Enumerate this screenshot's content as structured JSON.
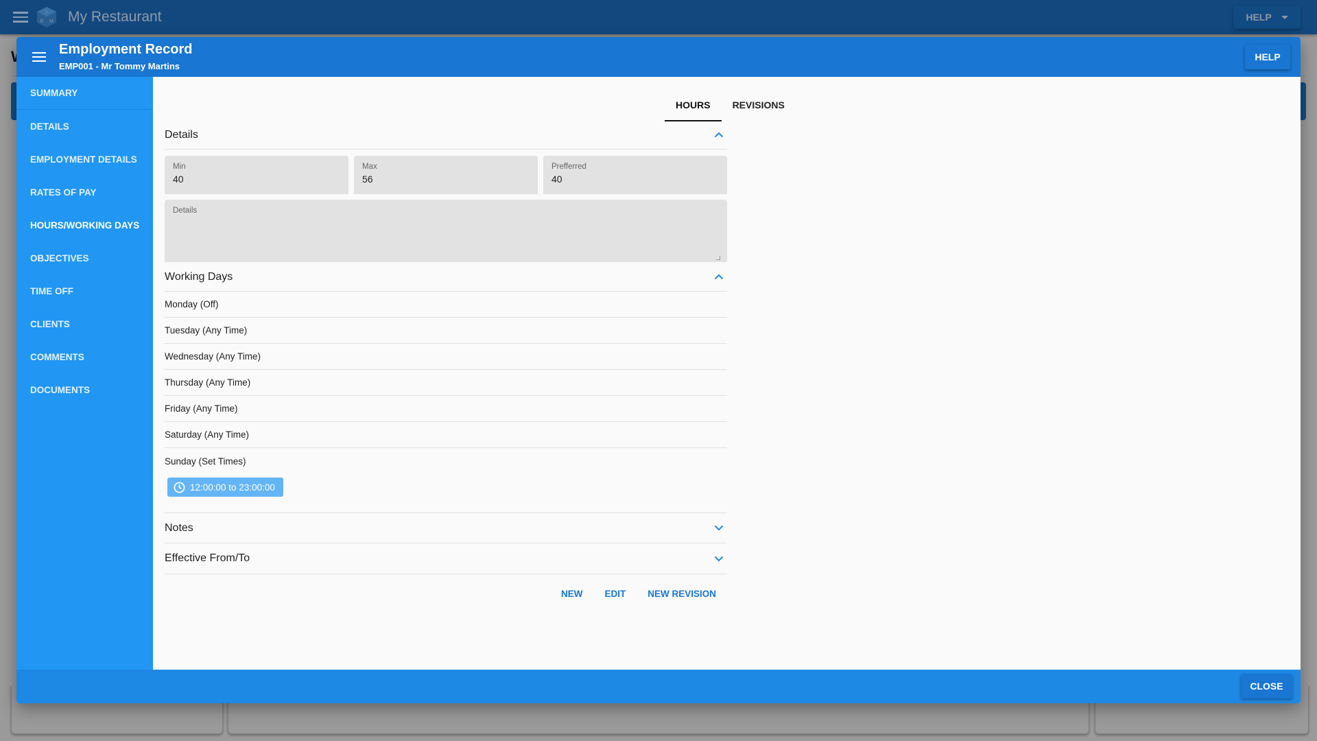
{
  "app": {
    "title": "My Restaurant",
    "help_menu_label": "HELP",
    "background_heading_initial": "W"
  },
  "modal": {
    "title": "Employment Record",
    "subtitle": "EMP001 - Mr Tommy Martins",
    "help_label": "HELP",
    "close_label": "CLOSE"
  },
  "sidebar": {
    "active": "HOURS/WORKING DAYS",
    "items": [
      {
        "label": "SUMMARY"
      },
      {
        "label": "DETAILS"
      },
      {
        "label": "EMPLOYMENT DETAILS"
      },
      {
        "label": "RATES OF PAY"
      },
      {
        "label": "HOURS/WORKING DAYS"
      },
      {
        "label": "OBJECTIVES"
      },
      {
        "label": "TIME OFF"
      },
      {
        "label": "CLIENTS"
      },
      {
        "label": "COMMENTS"
      },
      {
        "label": "DOCUMENTS"
      }
    ]
  },
  "tabs": [
    {
      "label": "HOURS",
      "active": true
    },
    {
      "label": "REVISIONS",
      "active": false
    }
  ],
  "details": {
    "heading": "Details",
    "min": {
      "label": "Min",
      "value": "40"
    },
    "max": {
      "label": "Max",
      "value": "56"
    },
    "preferred": {
      "label": "Prefferred",
      "value": "40"
    },
    "notes_field": {
      "label": "Details",
      "value": ""
    }
  },
  "working_days": {
    "heading": "Working Days",
    "days": [
      {
        "label": "Monday (Off)"
      },
      {
        "label": "Tuesday (Any Time)"
      },
      {
        "label": "Wednesday (Any Time)"
      },
      {
        "label": "Thursday (Any Time)"
      },
      {
        "label": "Friday (Any Time)"
      },
      {
        "label": "Saturday (Any Time)"
      },
      {
        "label": "Sunday (Set Times)"
      }
    ],
    "sunday_time_chip": "12:00:00 to 23:00:00"
  },
  "sections": {
    "notes": "Notes",
    "effective": "Effective From/To"
  },
  "actions": {
    "new": "NEW",
    "edit": "EDIT",
    "new_revision": "NEW REVISION"
  },
  "colors": {
    "app_bar": "#12487e",
    "modal_header": "#1976d2",
    "sidebar": "#2196f3",
    "footer": "#1e88e5",
    "chip": "#64b5f6",
    "action_text": "#1976d2"
  }
}
